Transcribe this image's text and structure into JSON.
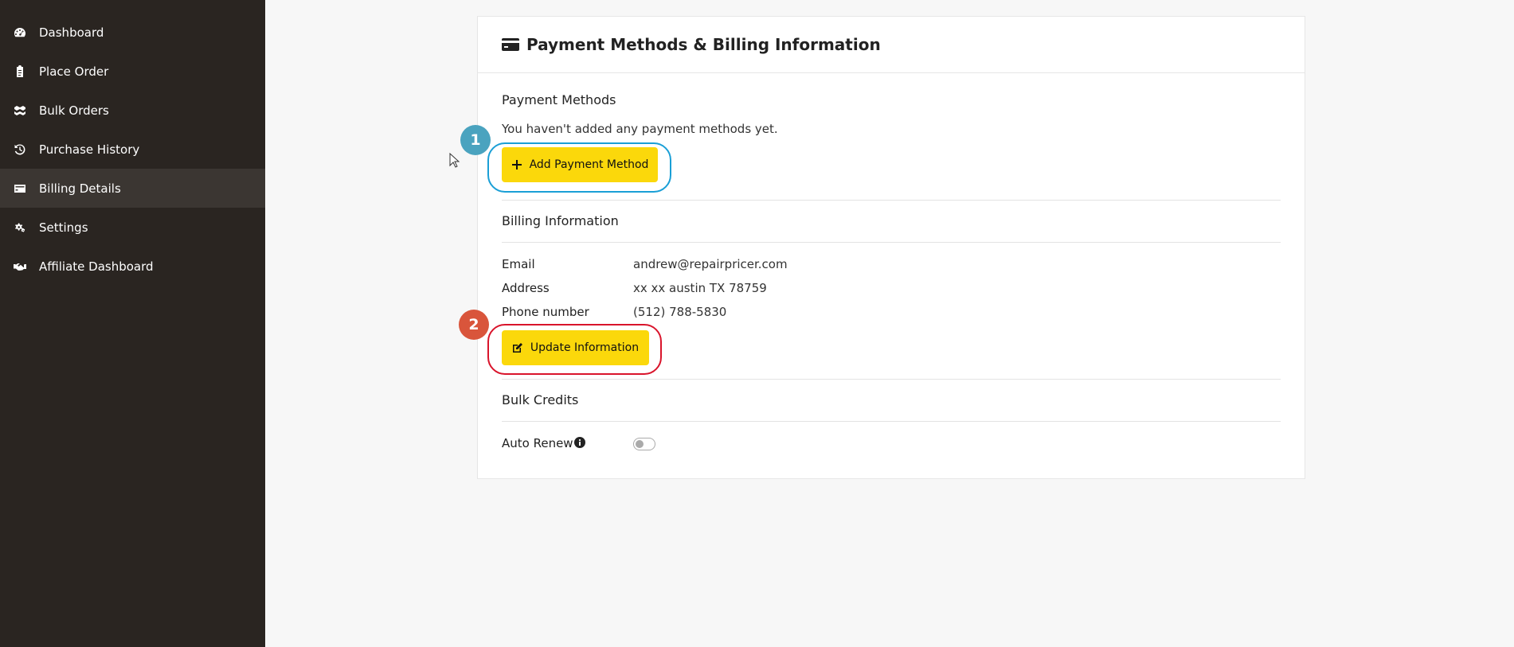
{
  "sidebar": {
    "items": [
      {
        "label": "Dashboard",
        "icon": "tachometer-icon"
      },
      {
        "label": "Place Order",
        "icon": "clipboard-icon"
      },
      {
        "label": "Bulk Orders",
        "icon": "boxes-icon"
      },
      {
        "label": "Purchase History",
        "icon": "history-icon"
      },
      {
        "label": "Billing Details",
        "icon": "credit-card-icon",
        "active": true
      },
      {
        "label": "Settings",
        "icon": "cogs-icon"
      },
      {
        "label": "Affiliate Dashboard",
        "icon": "handshake-icon"
      }
    ]
  },
  "card": {
    "title": "Payment Methods & Billing Information",
    "payment_methods": {
      "title": "Payment Methods",
      "empty_text": "You haven't added any payment methods yet.",
      "add_label": "Add Payment Method"
    },
    "billing": {
      "title": "Billing Information",
      "email_label": "Email",
      "email_value": "andrew@repairpricer.com",
      "address_label": "Address",
      "address_value": "xx xx austin TX 78759",
      "phone_label": "Phone number",
      "phone_value": "(512) 788-5830",
      "update_label": "Update Information"
    },
    "bulk_credits": {
      "title": "Bulk Credits",
      "auto_renew_label": "Auto Renew",
      "auto_renew_enabled": false
    }
  },
  "annotations": [
    {
      "number": "1",
      "color": "#1a9fd6",
      "badge_color": "#4aa3bf"
    },
    {
      "number": "2",
      "color": "#d9142b",
      "badge_color": "#d9553b"
    }
  ],
  "colors": {
    "sidebar_bg": "#2a2521",
    "accent_button": "#fbd80b"
  }
}
